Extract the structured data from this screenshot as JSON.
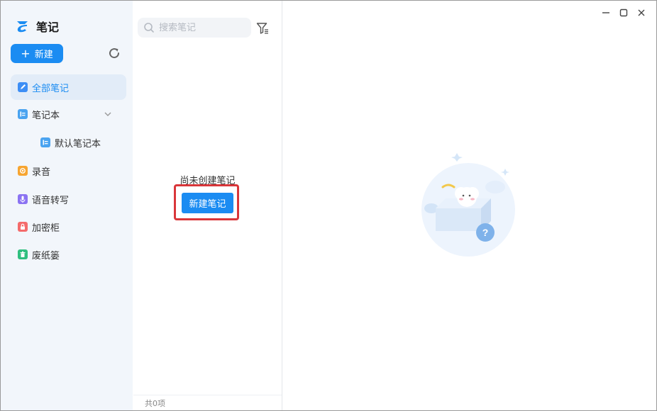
{
  "app": {
    "name": "笔记"
  },
  "sidebar": {
    "new_label": "新建",
    "items": [
      {
        "label": "全部笔记",
        "icon": "all-notes-icon",
        "color": "#3d8ef5"
      },
      {
        "label": "笔记本",
        "icon": "notebook-icon",
        "color": "#4aa3f0"
      },
      {
        "label": "默认笔记本",
        "icon": "notebook-icon",
        "color": "#4aa3f0"
      },
      {
        "label": "录音",
        "icon": "recording-icon",
        "color": "#f7a531"
      },
      {
        "label": "语音转写",
        "icon": "microphone-icon",
        "color": "#8b73f2"
      },
      {
        "label": "加密柜",
        "icon": "lock-icon",
        "color": "#f46b6b"
      },
      {
        "label": "废纸篓",
        "icon": "trash-icon",
        "color": "#2fbf7f"
      }
    ]
  },
  "list": {
    "search_placeholder": "搜索笔记",
    "empty_text": "尚未创建笔记",
    "create_label": "新建笔记",
    "footer": "共0项"
  },
  "colors": {
    "accent": "#1b8cf2",
    "highlight": "#d9363a",
    "sidebar_bg": "#f2f6fb"
  }
}
